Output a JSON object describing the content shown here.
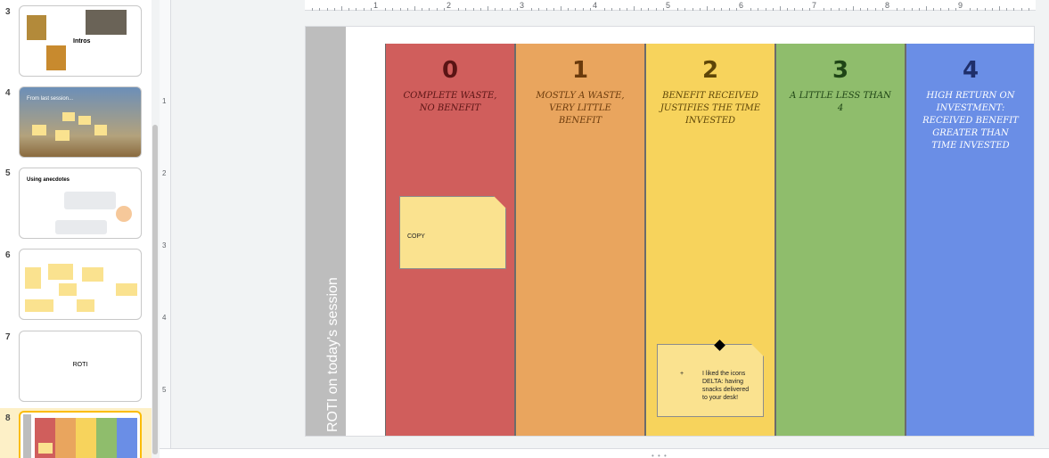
{
  "filmstrip": {
    "slides": [
      {
        "number": "3",
        "title": "Intros"
      },
      {
        "number": "4",
        "title": "From last session..."
      },
      {
        "number": "5",
        "title": "Using anecdotes"
      },
      {
        "number": "6",
        "title": ""
      },
      {
        "number": "7",
        "title": "ROTI"
      },
      {
        "number": "8",
        "title": ""
      }
    ]
  },
  "ruler": {
    "horizontal": [
      "1",
      "2",
      "3",
      "4",
      "5",
      "6",
      "7",
      "8",
      "9"
    ],
    "vertical": [
      "1",
      "2",
      "3",
      "4",
      "5"
    ]
  },
  "slide": {
    "side_title": "ROTI on today's session",
    "columns": [
      {
        "score": "0",
        "desc": "Complete waste, no benefit",
        "color": "#d05e5c",
        "text_color": "#5a1414"
      },
      {
        "score": "1",
        "desc": "Mostly a waste, very little benefit",
        "color": "#e9a55e",
        "text_color": "#6a3a0c"
      },
      {
        "score": "2",
        "desc": "Benefit received justifies the time invested",
        "color": "#f7d35c",
        "text_color": "#5e4608"
      },
      {
        "score": "3",
        "desc": "A little less than 4",
        "color": "#8fbd6c",
        "text_color": "#1f4516"
      },
      {
        "score": "4",
        "desc": "High return on investment: received benefit greater than time invested",
        "color": "#6a8ee6",
        "text_color": "#ffffff"
      }
    ],
    "notes": [
      {
        "text": "COPY"
      },
      {
        "bullet": "+",
        "text": "I liked the icons DELTA: having snacks delivered to your desk!"
      }
    ]
  },
  "colors": {
    "accent": "#fbbc04",
    "selected_bg": "#fdf0c7"
  }
}
